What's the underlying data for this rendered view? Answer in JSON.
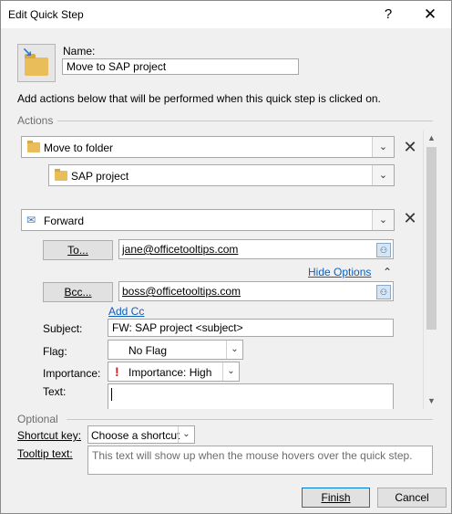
{
  "window": {
    "title": "Edit Quick Step",
    "help_glyph": "?",
    "close_glyph": "✕"
  },
  "quickstep": {
    "name_label": "Name:",
    "name_value": "Move to SAP project",
    "icon": "folder-move-icon"
  },
  "intro_text": "Add actions below that will be performed when this quick step is clicked on.",
  "actions": {
    "section_label": "Actions",
    "move": {
      "action_label": "Move to folder",
      "folder_value": "SAP project"
    },
    "forward": {
      "action_label": "Forward",
      "to_button": "To...",
      "to_value": "jane@officetooltips.com",
      "hide_options": "Hide Options",
      "collapse_glyph": "⌃",
      "bcc_button": "Bcc...",
      "bcc_value": "boss@officetooltips.com",
      "add_cc": "Add Cc",
      "subject_label": "Subject:",
      "subject_value": "FW: SAP project <subject>",
      "flag_label": "Flag:",
      "flag_value": "No Flag",
      "importance_label": "Importance:",
      "importance_value": "Importance: High",
      "importance_mark": "!",
      "text_label": "Text:"
    },
    "delete_glyph": "✕",
    "dropdown_glyph": "⌄"
  },
  "optional": {
    "section_label": "Optional",
    "shortcut_label": "Shortcut key:",
    "shortcut_value": "Choose a shortcut",
    "tooltip_label": "Tooltip text:",
    "tooltip_placeholder": "This text will show up when the mouse hovers over the quick step."
  },
  "buttons": {
    "finish": "Finish",
    "cancel": "Cancel"
  },
  "colors": {
    "accent": "#0078d7",
    "folder": "#e8bd5a",
    "link": "#0f5fb8",
    "importance": "#d21f1f"
  }
}
